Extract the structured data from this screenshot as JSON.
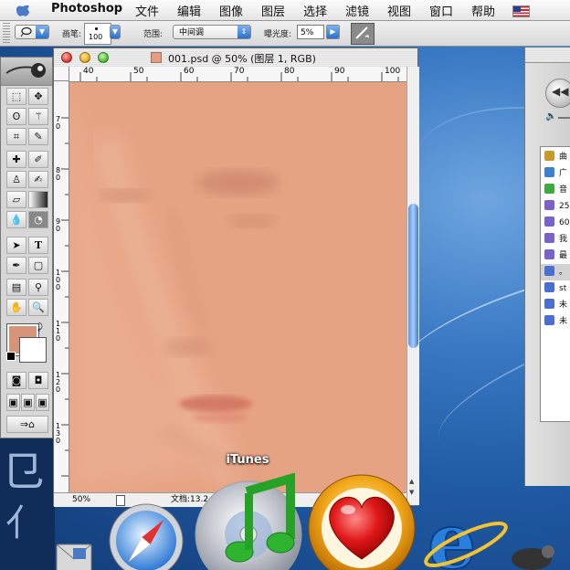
{
  "menubar": {
    "items": [
      "Photoshop",
      "文件",
      "编辑",
      "图像",
      "图层",
      "选择",
      "滤镜",
      "视图",
      "窗口",
      "帮助"
    ]
  },
  "options": {
    "brush_label": "画笔:",
    "brush_size": "100",
    "range_label": "范围:",
    "range_value": "中间调",
    "exposure_label": "曝光度:",
    "exposure_value": "5%"
  },
  "document": {
    "title": "001.psd @ 50% (图层 1, RGB)",
    "zoom": "50%",
    "doc_info": "文档:13.2",
    "canvas_color": "#e6a383",
    "h_ruler_ticks": [
      "40",
      "50",
      "60",
      "70",
      "80",
      "90",
      "100"
    ],
    "v_ruler_ticks": [
      "70",
      "80",
      "90",
      "100",
      "110",
      "120",
      "130"
    ]
  },
  "itunes": {
    "sources": [
      {
        "label": "曲",
        "icon_color": "#c79a2a"
      },
      {
        "label": "广",
        "icon_color": "#3f7fd0"
      },
      {
        "label": "音",
        "icon_color": "#3caa3c"
      },
      {
        "label": "25",
        "icon_color": "#7b62c8"
      },
      {
        "label": "60",
        "icon_color": "#7b62c8"
      },
      {
        "label": "我",
        "icon_color": "#7b62c8"
      },
      {
        "label": "最",
        "icon_color": "#7b62c8"
      },
      {
        "label": "。",
        "icon_color": "#4a6fd0"
      },
      {
        "label": "st",
        "icon_color": "#4a6fd0"
      },
      {
        "label": "未",
        "icon_color": "#4a6fd0"
      },
      {
        "label": "未",
        "icon_color": "#4a6fd0"
      }
    ]
  },
  "dock": {
    "hover_label": "iTunes",
    "apps": [
      "mail-icon",
      "safari-icon",
      "itunes-icon",
      "favorites-heart-icon",
      "internet-explorer-icon",
      "system-icon"
    ]
  },
  "colors": {
    "foreground": "#d89478",
    "background": "#ffffff",
    "accent": "#2a6fcf"
  }
}
